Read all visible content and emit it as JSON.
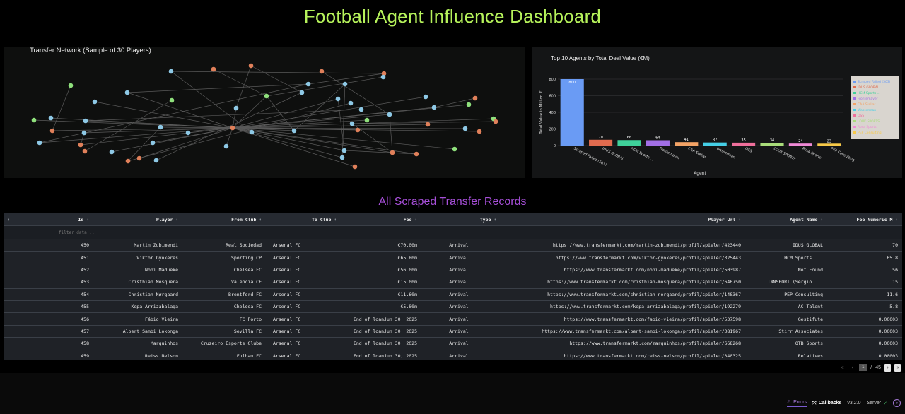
{
  "page_title": "Football Agent Influence Dashboard",
  "network": {
    "title": "Transfer Network (Sample of 30 Players)",
    "colors": {
      "player": "#8ec9e6",
      "club": "#e0805a",
      "agent": "#8fe07c",
      "edge": "#5a5a5a"
    }
  },
  "chart_data": {
    "type": "bar",
    "title": "Top 10 Agents by Total Deal Value (€M)",
    "xlabel": "Agent",
    "ylabel": "Total Value in Million €",
    "ylim": [
      0,
      800
    ],
    "yticks": [
      0,
      200,
      400,
      600,
      800
    ],
    "categories": [
      "Scraped Failed (503)",
      "IDUS GLOBAL",
      "HCM Sports ...",
      "Frontemayer",
      "CAA Stellar",
      "Wasserman",
      "OSS",
      "LOUK SPORTS",
      "Rosa Sports",
      "PEP Consulting"
    ],
    "values": [
      800,
      70,
      66,
      64,
      41,
      37,
      35,
      34,
      24,
      23
    ],
    "colors": [
      "#6a9bf4",
      "#e06b4f",
      "#3fd19a",
      "#a26fe6",
      "#f3a366",
      "#45cfe6",
      "#ef6f9b",
      "#a9dc7a",
      "#f08ad6",
      "#f7c948"
    ],
    "legend_position": "right",
    "grid": true
  },
  "table": {
    "section_title": "All Scraped Transfer Records",
    "filter_placeholder": "filter data...",
    "columns": [
      "Id",
      "Player",
      "From Club",
      "To Club",
      "Fee",
      "Type",
      "Player Url",
      "Agent Name",
      "Fee Numeric M"
    ],
    "rows": [
      [
        "450",
        "Martin Zubimendi",
        "Real Sociedad",
        "Arsenal FC",
        "€70.00m",
        "Arrival",
        "https://www.transfermarkt.com/martin-zubimendi/profil/spieler/423440",
        "IDUS GLOBAL",
        "70"
      ],
      [
        "451",
        "Viktor Gyökeres",
        "Sporting CP",
        "Arsenal FC",
        "€65.80m",
        "Arrival",
        "https://www.transfermarkt.com/viktor-gyokeres/profil/spieler/325443",
        "HCM Sports ...",
        "65.8"
      ],
      [
        "452",
        "Noni Madueke",
        "Chelsea FC",
        "Arsenal FC",
        "€56.00m",
        "Arrival",
        "https://www.transfermarkt.com/noni-madueke/profil/spieler/503987",
        "Not Found",
        "56"
      ],
      [
        "453",
        "Cristhian Mosquera",
        "Valencia CF",
        "Arsenal FC",
        "€15.00m",
        "Arrival",
        "https://www.transfermarkt.com/cristhian-mosquera/profil/spieler/646750",
        "INNSPORT (Sergio ...",
        "15"
      ],
      [
        "454",
        "Christian Nørgaard",
        "Brentford FC",
        "Arsenal FC",
        "€11.60m",
        "Arrival",
        "https://www.transfermarkt.com/christian-norgaard/profil/spieler/148367",
        "PEP Consulting",
        "11.6"
      ],
      [
        "455",
        "Kepa Arrizabalaga",
        "Chelsea FC",
        "Arsenal FC",
        "€5.80m",
        "Arrival",
        "https://www.transfermarkt.com/kepa-arrizabalaga/profil/spieler/192279",
        "AC Talent",
        "5.8"
      ],
      [
        "456",
        "Fábio Vieira",
        "FC Porto",
        "Arsenal FC",
        "End of loanJun 30, 2025",
        "Arrival",
        "https://www.transfermarkt.com/fabio-vieira/profil/spieler/537598",
        "Gestifute",
        "0.00003"
      ],
      [
        "457",
        "Albert Sambi Lokonga",
        "Sevilla FC",
        "Arsenal FC",
        "End of loanJun 30, 2025",
        "Arrival",
        "https://www.transfermarkt.com/albert-sambi-lokonga/profil/spieler/381967",
        "Stirr Associates",
        "0.00003"
      ],
      [
        "458",
        "Marquinhos",
        "Cruzeiro Esporte Clube",
        "Arsenal FC",
        "End of loanJun 30, 2025",
        "Arrival",
        "https://www.transfermarkt.com/marquinhos/profil/spieler/668268",
        "OTB Sports",
        "0.00003"
      ],
      [
        "459",
        "Reiss Nelson",
        "Fulham FC",
        "Arsenal FC",
        "End of loanJun 30, 2025",
        "Arrival",
        "https://www.transfermarkt.com/reiss-nelson/profil/spieler/340325",
        "Relatives",
        "0.00003"
      ]
    ]
  },
  "pager": {
    "current_page": "1",
    "separator": "/",
    "total_pages": "45"
  },
  "devtools": {
    "errors": "Errors",
    "callbacks": "Callbacks",
    "version": "v3.2.0",
    "server": "Server",
    "server_status": "✓"
  }
}
